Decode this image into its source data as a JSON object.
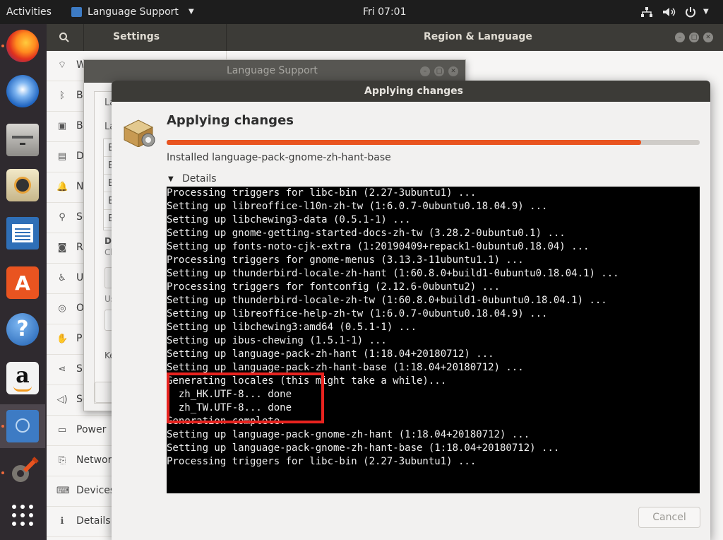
{
  "topbar": {
    "activities": "Activities",
    "app_menu": "Language Support",
    "clock": "Fri 07:01"
  },
  "dock": {
    "items": [
      "firefox",
      "thunderbird",
      "files",
      "rhythmbox",
      "writer",
      "software",
      "help",
      "amazon",
      "language-support",
      "settings",
      "show-apps"
    ]
  },
  "settings": {
    "title_left": "Settings",
    "title_right": "Region & Language",
    "sidebar": [
      {
        "label": "W",
        "icon": "wifi-icon"
      },
      {
        "label": "B",
        "icon": "bluetooth-icon"
      },
      {
        "label": "B",
        "icon": "background-icon"
      },
      {
        "label": "D",
        "icon": "dock-icon"
      },
      {
        "label": "N",
        "icon": "bell-icon"
      },
      {
        "label": "Se",
        "icon": "search-icon"
      },
      {
        "label": "R",
        "icon": "camera-icon"
      },
      {
        "label": "U",
        "icon": "universal-access-icon"
      },
      {
        "label": "O",
        "icon": "online-accounts-icon"
      },
      {
        "label": "P",
        "icon": "hand-icon"
      },
      {
        "label": "Sh",
        "icon": "share-icon"
      },
      {
        "label": "So",
        "icon": "sound-icon"
      },
      {
        "label": "Power",
        "icon": "power-icon"
      },
      {
        "label": "Networ",
        "icon": "network-icon"
      },
      {
        "label": "Devices",
        "icon": "devices-icon"
      },
      {
        "label": "Details",
        "icon": "info-icon"
      }
    ]
  },
  "langsup": {
    "title": "Language Support",
    "tab": "La",
    "label_la": "La",
    "list_items": [
      "E",
      "E",
      "E",
      "E",
      "E"
    ],
    "dr": "Dr",
    "ch": "Ch",
    "us": "Us",
    "ke": "Ke"
  },
  "apply": {
    "window_title": "Applying changes",
    "heading": "Applying changes",
    "progress": 0.89,
    "status": "Installed language-pack-gnome-zh-hant-base",
    "details_label": "Details",
    "cancel": "Cancel",
    "log": [
      "Processing triggers for libc-bin (2.27-3ubuntu1) ...",
      "Setting up libreoffice-l10n-zh-tw (1:6.0.7-0ubuntu0.18.04.9) ...",
      "Setting up libchewing3-data (0.5.1-1) ...",
      "Setting up gnome-getting-started-docs-zh-tw (3.28.2-0ubuntu0.1) ...",
      "Setting up fonts-noto-cjk-extra (1:20190409+repack1-0ubuntu0.18.04) ...",
      "Processing triggers for gnome-menus (3.13.3-11ubuntu1.1) ...",
      "Setting up thunderbird-locale-zh-hant (1:60.8.0+build1-0ubuntu0.18.04.1) ...",
      "Processing triggers for fontconfig (2.12.6-0ubuntu2) ...",
      "Setting up thunderbird-locale-zh-tw (1:60.8.0+build1-0ubuntu0.18.04.1) ...",
      "Setting up libreoffice-help-zh-tw (1:6.0.7-0ubuntu0.18.04.9) ...",
      "Setting up libchewing3:amd64 (0.5.1-1) ...",
      "Setting up ibus-chewing (1.5.1-1) ...",
      "Setting up language-pack-zh-hant (1:18.04+20180712) ...",
      "Setting up language-pack-zh-hant-base (1:18.04+20180712) ...",
      "Generating locales (this might take a while)...",
      "  zh_HK.UTF-8... done",
      "  zh_TW.UTF-8... done",
      "Generation complete.",
      "Setting up language-pack-gnome-zh-hant (1:18.04+20180712) ...",
      "Setting up language-pack-gnome-zh-hant-base (1:18.04+20180712) ...",
      "Processing triggers for libc-bin (2.27-3ubuntu1) ..."
    ]
  },
  "colors": {
    "accent": "#e95420",
    "highlight_box": "#e8231f"
  }
}
